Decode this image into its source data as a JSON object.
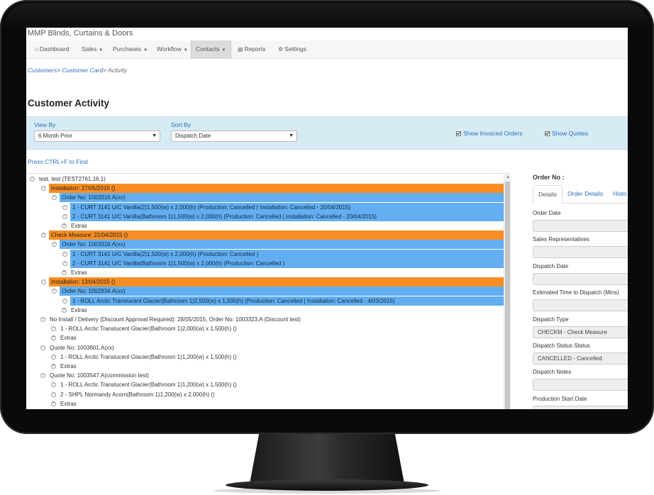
{
  "app": {
    "title": "MMP Blinds, Curtains & Doors"
  },
  "nav": {
    "items": [
      {
        "label": "Dashboard",
        "icon": "home-icon",
        "dropdown": false
      },
      {
        "label": "Sales",
        "icon": "",
        "dropdown": true
      },
      {
        "label": "Purchases",
        "icon": "",
        "dropdown": true
      },
      {
        "label": "Workflow",
        "icon": "",
        "dropdown": true
      },
      {
        "label": "Contacts",
        "icon": "",
        "dropdown": true,
        "active": true
      },
      {
        "label": "Reports",
        "icon": "chart-icon",
        "dropdown": false
      },
      {
        "label": "Settings",
        "icon": "gear-icon",
        "dropdown": false
      }
    ]
  },
  "breadcrumb": {
    "customers": "Customers",
    "customer_card": "Customer Card",
    "current": "Activity",
    "sep": ">"
  },
  "page": {
    "title": "Customer Activity"
  },
  "filters": {
    "view_by_label": "View By",
    "view_by_value": "6 Month Prior",
    "sort_by_label": "Sort By",
    "sort_by_value": "Dispatch Date",
    "show_invoiced_label": "Show Invoiced Orders",
    "show_invoiced_checked": true,
    "show_quotes_label": "Show Quotes",
    "show_quotes_checked": true
  },
  "find_hint": "Press CTRL+F to Find",
  "tree": [
    {
      "text": "test, test (TEST2761.16.1)",
      "level": 0,
      "style": "plain"
    },
    {
      "text": "Installation: 27/05/2015 ()",
      "level": 1,
      "style": "orange"
    },
    {
      "text": "Order No: 1003316.A(xx)",
      "level": 2,
      "style": "blue"
    },
    {
      "text": "1 - CURT 3141 U/C Vanilla(2)1,500(w) x 2,000(h) (Production: Cancelled | Installation: Cancelled - 20/04/2015)",
      "level": 3,
      "style": "blue"
    },
    {
      "text": "2 - CURT 3141 U/C Vanilla(Bathroom 1)1,500(w) x 2,000(h) (Production: Cancelled | Installation: Cancelled - 20/04/2015)",
      "level": 3,
      "style": "blue"
    },
    {
      "text": "Extras",
      "level": 3,
      "style": "plain"
    },
    {
      "text": "Check Measure: 21/04/2015 ()",
      "level": 1,
      "style": "orange"
    },
    {
      "text": "Order No: 1003316.A(xx)",
      "level": 2,
      "style": "blue"
    },
    {
      "text": "1 - CURT 3141 U/C Vanilla(2)1,500(w) x 2,000(h) (Production: Cancelled )",
      "level": 3,
      "style": "blue"
    },
    {
      "text": "2 - CURT 3141 U/C Vanilla(Bathroom 1)1,500(w) x 2,000(h) (Production: Cancelled )",
      "level": 3,
      "style": "blue"
    },
    {
      "text": "Extras",
      "level": 3,
      "style": "plain"
    },
    {
      "text": "Installation: 13/04/2015 ()",
      "level": 1,
      "style": "orange"
    },
    {
      "text": "Order No: 1002934.A(xx)",
      "level": 2,
      "style": "blue"
    },
    {
      "text": "1 - ROLL Arctic Translucent Glacier(Bathroom 1)2,500(w) x 1,500(h) (Production: Cancelled | Installation: Cancelled - 4/03/2015)",
      "level": 3,
      "style": "blue"
    },
    {
      "text": "Extras",
      "level": 3,
      "style": "plain"
    },
    {
      "text": "No Install / Delivery (Discount Approval Required): 28/05/2015, Order No: 1003323.A (Discount test)",
      "level": 1,
      "style": "plain"
    },
    {
      "text": "1 - ROLL Arctic Translucent Glacier(Bathroom 1)2,000(w) x 1,500(h) ()",
      "level": 2,
      "style": "plain"
    },
    {
      "text": "Extras",
      "level": 2,
      "style": "plain"
    },
    {
      "text": "Quote No: 1003601.A(xx)",
      "level": 1,
      "style": "plain"
    },
    {
      "text": "1 - ROLL Arctic Translucent Glacier(Bathroom 1)1,200(w) x 1,500(h) ()",
      "level": 2,
      "style": "plain"
    },
    {
      "text": "Extras",
      "level": 2,
      "style": "plain"
    },
    {
      "text": "Quote No: 1003547.A(commission test)",
      "level": 1,
      "style": "plain"
    },
    {
      "text": "1 - ROLL Arctic Translucent Glacier(Bathroom 1)1,200(w) x 1,500(h) ()",
      "level": 2,
      "style": "plain"
    },
    {
      "text": "2 - SHPL Normandy Acorn(Bathroom 1)1,200(w) x 2,000(h) ()",
      "level": 2,
      "style": "plain"
    },
    {
      "text": "Extras",
      "level": 2,
      "style": "plain"
    }
  ],
  "details": {
    "order_no_label": "Order No :",
    "tabs": [
      "Details",
      "Order Details",
      "Histo"
    ],
    "fields": [
      {
        "label": "Order Date",
        "value": ""
      },
      {
        "label": "Sales Representatives",
        "value": ""
      },
      {
        "label": "Dispatch Date",
        "value": ""
      },
      {
        "label": "Estimated Time to Dispatch (Mins)",
        "value": ""
      },
      {
        "label": "Dispatch Type",
        "value": "CHECKM - Check Measure"
      },
      {
        "label": "Dispatch Status Status",
        "value": "CANCELLED - Cancelled"
      },
      {
        "label": "Dispatch Notes",
        "value": ""
      },
      {
        "label": "Production Start Date",
        "value": ""
      }
    ]
  },
  "colors": {
    "orange_row": "#f98d23",
    "blue_row": "#62aef0",
    "filter_panel": "#d7ebf5",
    "link": "#2a6ebb"
  }
}
